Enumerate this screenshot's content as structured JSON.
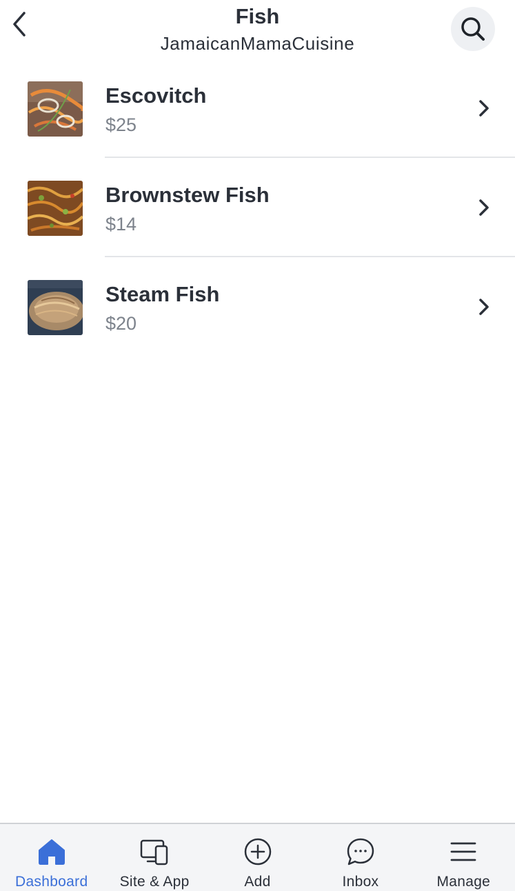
{
  "header": {
    "title": "Fish",
    "subtitle": "JamaicanMamaCuisine",
    "back_icon": "chevron-left-icon",
    "search_icon": "search-icon"
  },
  "items": [
    {
      "name": "Escovitch",
      "price": "$25",
      "thumb": "escovitch-photo"
    },
    {
      "name": "Brownstew Fish",
      "price": "$14",
      "thumb": "brownstew-fish-photo"
    },
    {
      "name": "Steam Fish",
      "price": "$20",
      "thumb": "steam-fish-photo"
    }
  ],
  "bottom_nav": [
    {
      "label": "Dashboard",
      "icon": "home-icon",
      "active": true
    },
    {
      "label": "Site & App",
      "icon": "devices-icon",
      "active": false
    },
    {
      "label": "Add",
      "icon": "add-circle-icon",
      "active": false
    },
    {
      "label": "Inbox",
      "icon": "chat-bubble-icon",
      "active": false
    },
    {
      "label": "Manage",
      "icon": "menu-icon",
      "active": false
    }
  ],
  "colors": {
    "text_primary": "#2b3039",
    "text_secondary": "#7d838c",
    "accent": "#3b6fd8",
    "nav_background": "#f4f5f7"
  }
}
